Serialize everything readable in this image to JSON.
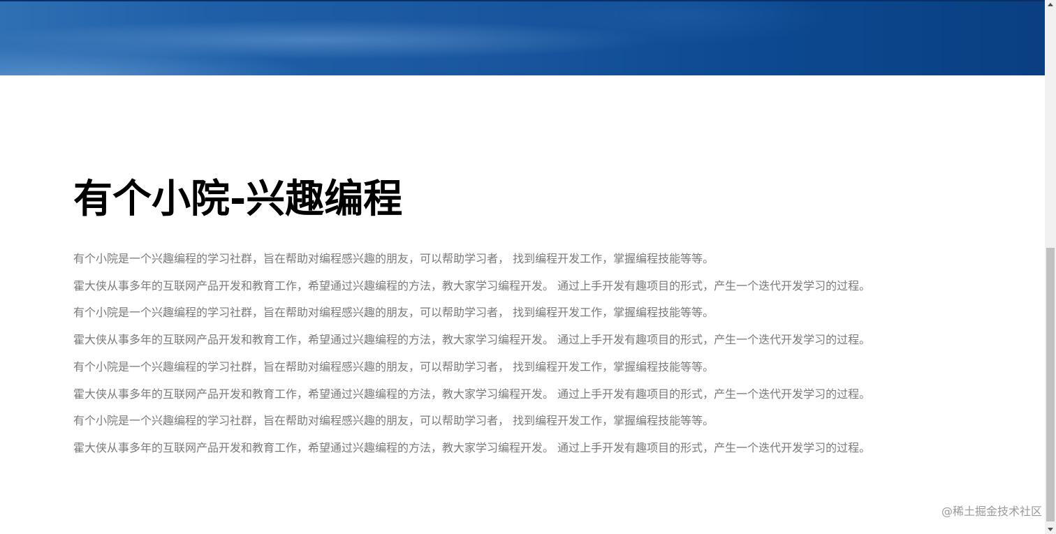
{
  "hero": {
    "image": "blue-banner"
  },
  "main": {
    "title": "有个小院-兴趣编程",
    "paragraphs": [
      "有个小院是一个兴趣编程的学习社群，旨在帮助对编程感兴趣的朋友，可以帮助学习者， 找到编程开发工作，掌握编程技能等等。",
      "霍大侠从事多年的互联网产品开发和教育工作，希望通过兴趣编程的方法，教大家学习编程开发。 通过上手开发有趣项目的形式，产生一个迭代开发学习的过程。",
      "有个小院是一个兴趣编程的学习社群，旨在帮助对编程感兴趣的朋友，可以帮助学习者， 找到编程开发工作，掌握编程技能等等。",
      "霍大侠从事多年的互联网产品开发和教育工作，希望通过兴趣编程的方法，教大家学习编程开发。 通过上手开发有趣项目的形式，产生一个迭代开发学习的过程。",
      "有个小院是一个兴趣编程的学习社群，旨在帮助对编程感兴趣的朋友，可以帮助学习者， 找到编程开发工作，掌握编程技能等等。",
      "霍大侠从事多年的互联网产品开发和教育工作，希望通过兴趣编程的方法，教大家学习编程开发。 通过上手开发有趣项目的形式，产生一个迭代开发学习的过程。",
      "有个小院是一个兴趣编程的学习社群，旨在帮助对编程感兴趣的朋友，可以帮助学习者， 找到编程开发工作，掌握编程技能等等。",
      "霍大侠从事多年的互联网产品开发和教育工作，希望通过兴趣编程的方法，教大家学习编程开发。 通过上手开发有趣项目的形式，产生一个迭代开发学习的过程。"
    ]
  },
  "watermark": {
    "text": "@稀土掘金技术社区"
  },
  "colors": {
    "title": "#000000",
    "paragraph": "#7a7a7a",
    "banner": "#1a57a0"
  }
}
